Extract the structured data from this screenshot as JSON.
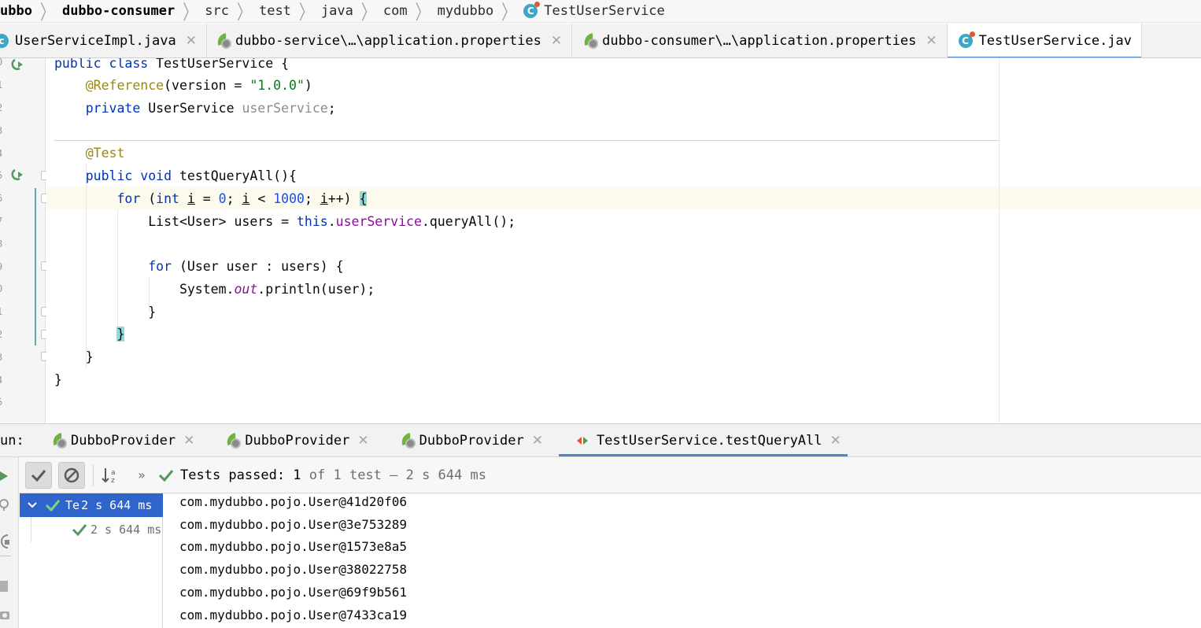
{
  "breadcrumb": {
    "items": [
      "ubbo",
      "dubbo-consumer",
      "src",
      "test",
      "java",
      "com",
      "mydubbo",
      "TestUserService"
    ]
  },
  "editor_tabs": [
    {
      "label": "UserServiceImpl.java",
      "icon": "class-icon"
    },
    {
      "label": "dubbo-service\\…\\application.properties",
      "icon": "spring-properties-icon"
    },
    {
      "label": "dubbo-consumer\\…\\application.properties",
      "icon": "spring-properties-icon"
    },
    {
      "label": "TestUserService.jav",
      "icon": "test-class-icon",
      "active": true
    }
  ],
  "gutter": {
    "line_numbers": [
      "0",
      "1",
      "2",
      "3",
      "4",
      "5",
      "6",
      "7",
      "8",
      "9",
      "0",
      "1",
      "2",
      "3",
      "4",
      "5"
    ]
  },
  "code": {
    "lines": [
      "public class TestUserService {",
      "    @Reference(version = \"1.0.0\")",
      "    private UserService userService;",
      "",
      "    @Test",
      "    public void testQueryAll(){",
      "        for (int i = 0; i < 1000; i++) {",
      "            List<User> users = this.userService.queryAll();",
      "",
      "            for (User user : users) {",
      "                System.out.println(user);",
      "            }",
      "        }",
      "    }",
      "}"
    ]
  },
  "run": {
    "label": "un:",
    "tabs": [
      {
        "label": "DubboProvider"
      },
      {
        "label": "DubboProvider"
      },
      {
        "label": "DubboProvider"
      },
      {
        "label": "TestUserService.testQueryAll",
        "active": true
      }
    ],
    "status": {
      "prefix": "Tests passed: ",
      "passed": "1",
      "suffix": " of 1 test – 2 s 644 ms"
    },
    "tree": {
      "root_label": "Te",
      "root_time": "2 s 644 ms",
      "child_time": "2 s 644 ms"
    },
    "console_lines": [
      "com.mydubbo.pojo.User@41d20f06",
      "com.mydubbo.pojo.User@3e753289",
      "com.mydubbo.pojo.User@1573e8a5",
      "com.mydubbo.pojo.User@38022758",
      "com.mydubbo.pojo.User@69f9b561",
      "com.mydubbo.pojo.User@7433ca19"
    ]
  },
  "colors": {
    "keyword": "#0033b3",
    "annotation": "#9e880d",
    "string": "#067d17",
    "number": "#1750eb",
    "field": "#871094",
    "accent": "#4a88c7",
    "selection": "#2f65ca",
    "pass": "#57965c"
  }
}
